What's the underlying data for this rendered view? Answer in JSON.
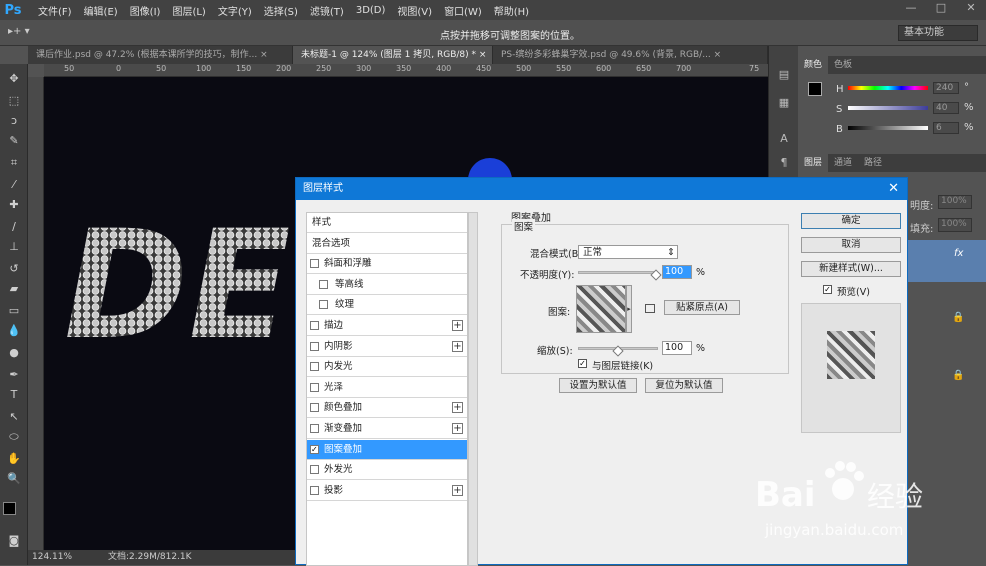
{
  "app": {
    "logo": "Ps"
  },
  "menu": [
    "文件(F)",
    "编辑(E)",
    "图像(I)",
    "图层(L)",
    "文字(Y)",
    "选择(S)",
    "滤镜(T)",
    "3D(D)",
    "视图(V)",
    "窗口(W)",
    "帮助(H)"
  ],
  "window_buttons": [
    "—",
    "□",
    "✕"
  ],
  "options": {
    "tool": "▸+ ▾",
    "hint": "点按并拖移可调整图案的位置。",
    "workspace": "基本功能"
  },
  "tabs": [
    {
      "label": "课后作业.psd @ 47.2% (根据本课所学的技巧，制作...",
      "close": "×"
    },
    {
      "label": "未标题-1 @ 124% (图层 1 拷贝, RGB/8) *",
      "close": "×"
    },
    {
      "label": "PS-缤纷多彩蜂巢字效.psd @ 49.6% (背景, RGB/...",
      "close": "×"
    }
  ],
  "ruler_labels": [
    "50",
    "0",
    "50",
    "100",
    "150",
    "200",
    "250",
    "300",
    "350",
    "400",
    "450",
    "500",
    "550",
    "600",
    "650",
    "700",
    "75"
  ],
  "canvas_text": "DE",
  "status": {
    "zoom": "124.11%",
    "doc": "文档:2.29M/812.1K"
  },
  "color_panel": {
    "tabs": [
      "颜色",
      "色板"
    ],
    "channels": [
      {
        "name": "H",
        "value": "240",
        "unit": "°"
      },
      {
        "name": "S",
        "value": "40",
        "unit": "%"
      },
      {
        "name": "B",
        "value": "6",
        "unit": "%"
      }
    ]
  },
  "layers_panel": {
    "tabs": [
      "图层",
      "通道",
      "路径"
    ],
    "opacity_label": "明度:",
    "opacity_value": "100%",
    "fill_label": "填充:",
    "fill_value": "100%",
    "fx": "fx"
  },
  "dialog": {
    "title": "图层样式",
    "close": "✕",
    "styles": [
      {
        "label": "样式",
        "checkbox": false,
        "plus": false,
        "indent": 0,
        "checked": false
      },
      {
        "label": "混合选项",
        "checkbox": false,
        "plus": false,
        "indent": 0,
        "checked": false
      },
      {
        "label": "斜面和浮雕",
        "checkbox": true,
        "plus": false,
        "indent": 0,
        "checked": false
      },
      {
        "label": "等高线",
        "checkbox": true,
        "plus": false,
        "indent": 1,
        "checked": false
      },
      {
        "label": "纹理",
        "checkbox": true,
        "plus": false,
        "indent": 1,
        "checked": false
      },
      {
        "label": "描边",
        "checkbox": true,
        "plus": true,
        "indent": 0,
        "checked": false
      },
      {
        "label": "内阴影",
        "checkbox": true,
        "plus": true,
        "indent": 0,
        "checked": false
      },
      {
        "label": "内发光",
        "checkbox": true,
        "plus": false,
        "indent": 0,
        "checked": false
      },
      {
        "label": "光泽",
        "checkbox": true,
        "plus": false,
        "indent": 0,
        "checked": false
      },
      {
        "label": "颜色叠加",
        "checkbox": true,
        "plus": true,
        "indent": 0,
        "checked": false
      },
      {
        "label": "渐变叠加",
        "checkbox": true,
        "plus": true,
        "indent": 0,
        "checked": false
      },
      {
        "label": "图案叠加",
        "checkbox": true,
        "plus": false,
        "indent": 0,
        "checked": true,
        "selected": true
      },
      {
        "label": "外发光",
        "checkbox": true,
        "plus": false,
        "indent": 0,
        "checked": false
      },
      {
        "label": "投影",
        "checkbox": true,
        "plus": true,
        "indent": 0,
        "checked": false
      }
    ],
    "section_title": "图案叠加",
    "group_title": "图案",
    "blend_label": "混合模式(B):",
    "blend_value": "正常",
    "opacity_label": "不透明度(Y):",
    "opacity_value": "100",
    "percent": "%",
    "pattern_label": "图案:",
    "snap_button": "贴紧原点(A)",
    "scale_label": "缩放(S):",
    "scale_value": "100",
    "link_label": "与图层链接(K)",
    "link_checked": true,
    "set_default": "设置为默认值",
    "reset_default": "复位为默认值",
    "ok": "确定",
    "cancel": "取消",
    "new_style": "新建样式(W)...",
    "preview_label": "预览(V)",
    "preview_checked": true
  },
  "watermark": {
    "brand": "Bai",
    "brand2": "经验",
    "url": "jingyan.baidu.com"
  }
}
